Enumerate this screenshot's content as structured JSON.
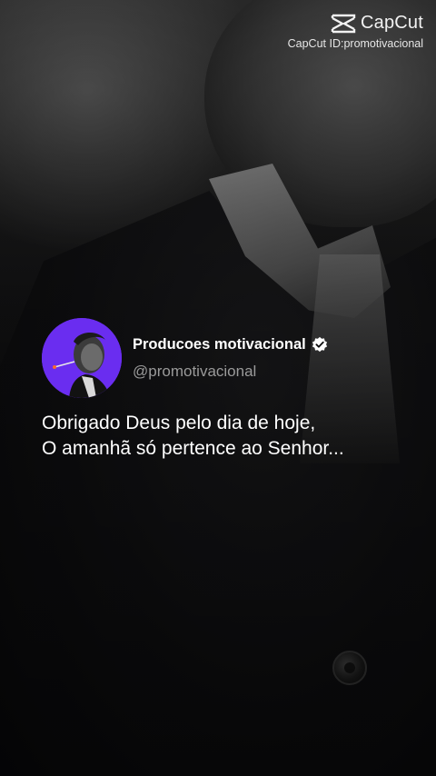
{
  "watermark": {
    "brand": "CapCut",
    "id_text": "CapCut ID:promotivacional",
    "logo_icon": "capcut-logo-icon"
  },
  "profile": {
    "display_name": "Producoes motivacional",
    "handle": "@promotivacional",
    "verified_icon": "verified-badge-icon",
    "avatar_bg": "#6a2df0"
  },
  "quote": {
    "lines": [
      "Obrigado Deus pelo dia de hoje,",
      "O amanhã só pertence ao Senhor..."
    ]
  }
}
